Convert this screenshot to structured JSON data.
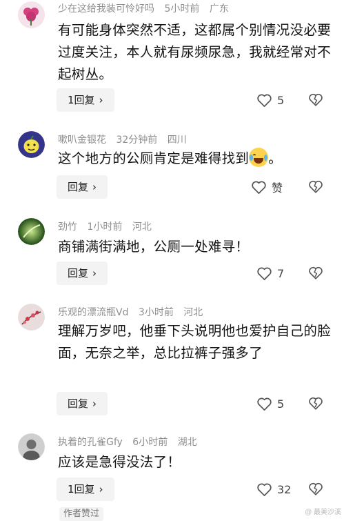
{
  "comments": [
    {
      "username": "少在这给我装可怜好吗",
      "time": "5小时前",
      "location": "广东",
      "avatar_color": "#d24a86",
      "text": "有可能身体突然不适，这都属个别情况没必要过度关注，本人就有尿频尿急，我就经常对不起树丛。",
      "reply_label": "1回复",
      "like_count": "5"
    },
    {
      "username": "嗽叭金银花",
      "time": "32分钟前",
      "location": "四川",
      "avatar_color": "#3b3a8a",
      "text": "这个地方的公厕肯定是难得找到",
      "text_suffix": "。",
      "reply_label": "回复",
      "like_count": "赞"
    },
    {
      "username": "劲竹",
      "time": "1小时前",
      "location": "河北",
      "avatar_color": "#3f7a28",
      "text": "商铺满街满地，公厕一处难寻！",
      "reply_label": "回复",
      "like_count": "7"
    },
    {
      "username": "乐观的漂流瓶Vd",
      "time": "3小时前",
      "location": "河北",
      "avatar_color": "#d9c7c9",
      "text": "理解万岁吧，他垂下头说明他也爱护自己的脸面，无奈之举，总比拉裤子强多了",
      "reply_label": "回复",
      "like_count": "5"
    },
    {
      "username": "执着的孔雀Gfy",
      "time": "6小时前",
      "location": "湖北",
      "avatar_color": "#bdbdbd",
      "text": "应该是急得没法了！",
      "reply_label": "1回复",
      "like_count": "32"
    }
  ],
  "author_liked": "作者赞过",
  "watermark": "@ 最美沙溪"
}
